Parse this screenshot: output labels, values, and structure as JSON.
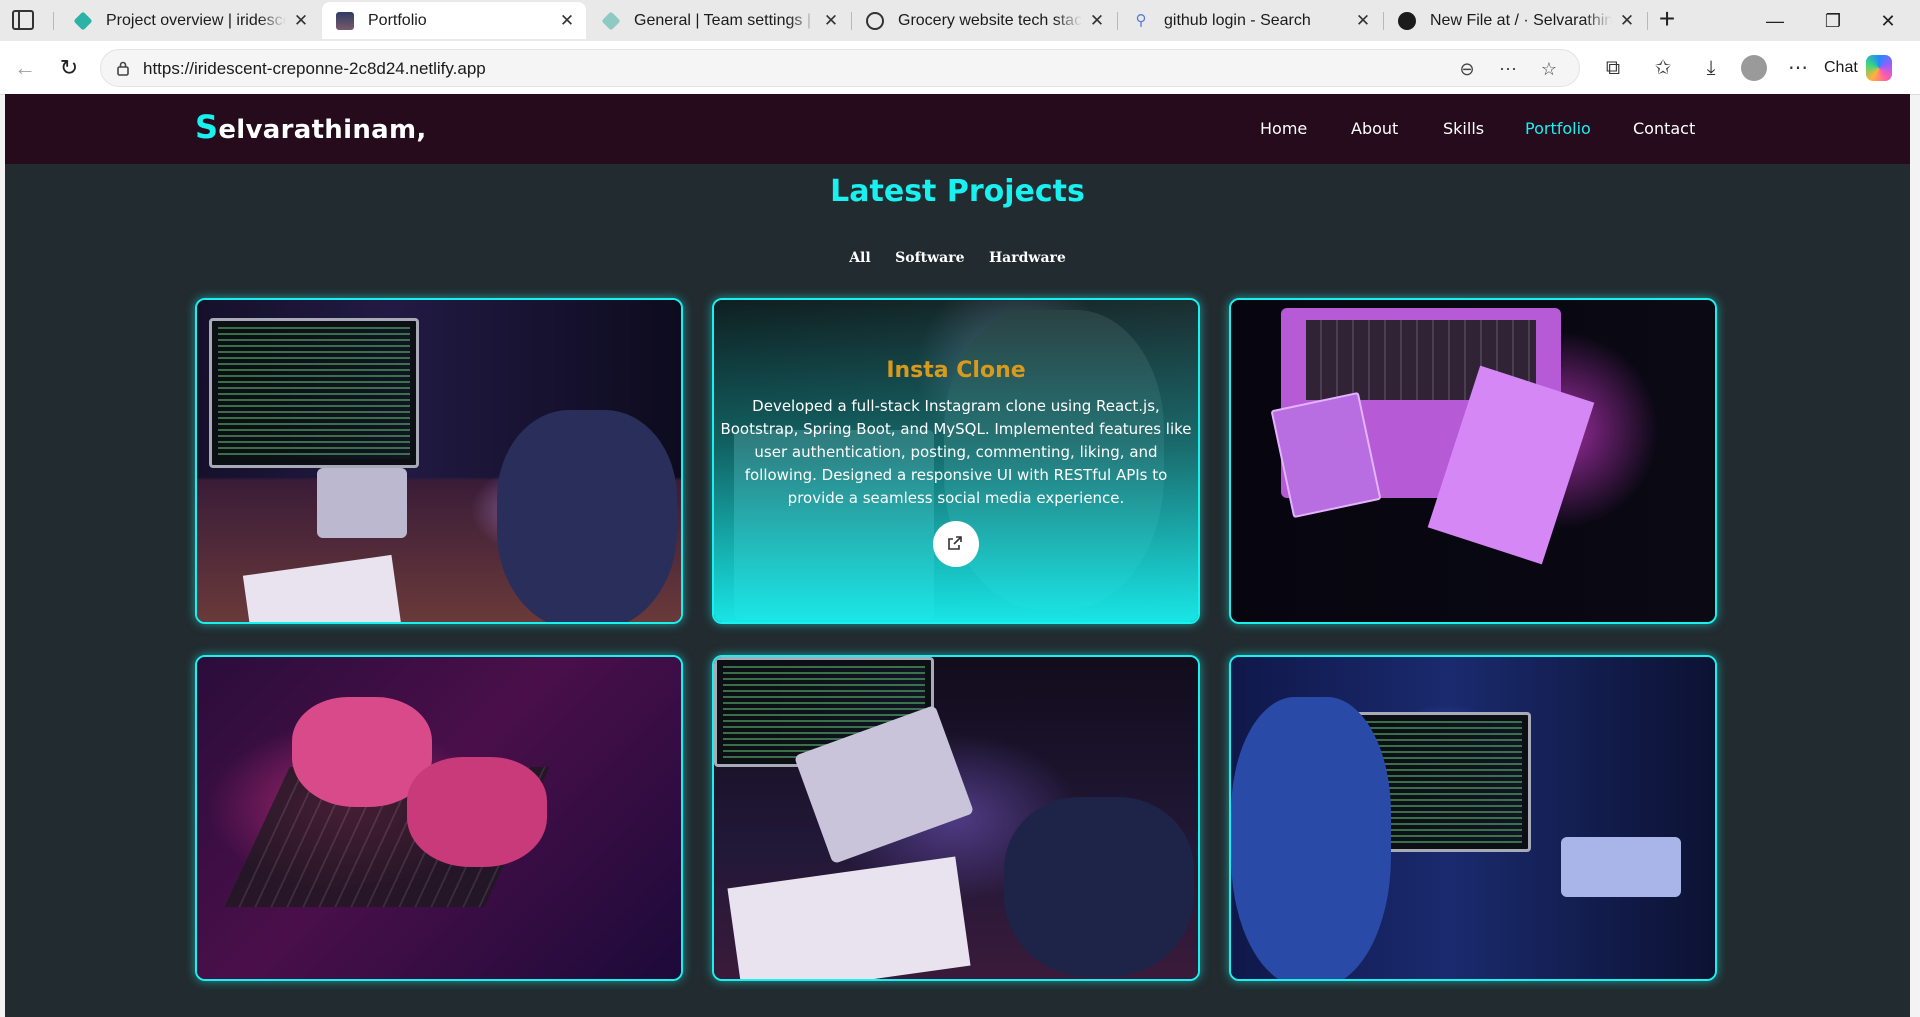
{
  "browser": {
    "tabs": [
      {
        "label": "Project overview | iridescent-creponne",
        "icon": "netlify-diamond-icon",
        "active": false
      },
      {
        "label": "Portfolio",
        "icon": "portfolio-favicon",
        "active": true
      },
      {
        "label": "General | Team settings | selvarathinam",
        "icon": "netlify-diamond-icon",
        "active": false
      },
      {
        "label": "Grocery website tech stack",
        "icon": "chatgpt-icon",
        "active": false
      },
      {
        "label": "github login - Search",
        "icon": "search-icon",
        "active": false
      },
      {
        "label": "New File at / · Selvarathinam",
        "icon": "github-icon",
        "active": false
      }
    ],
    "url": "https://iridescent-creponne-2c8d24.netlify.app",
    "chat_label": "Chat"
  },
  "site": {
    "brand_initial": "S",
    "brand_rest": "elvarathinam,",
    "nav": [
      {
        "label": "Home",
        "active": false
      },
      {
        "label": "About",
        "active": false
      },
      {
        "label": "Skills",
        "active": false
      },
      {
        "label": "Portfolio",
        "active": true
      },
      {
        "label": "Contact",
        "active": false
      }
    ],
    "accent_color": "#19f0f0",
    "nav_bg_color": "#250b1c",
    "section_title": "Latest Projects",
    "filters": [
      "All",
      "Software",
      "Hardware"
    ],
    "hovered_project": {
      "title": "Insta Clone",
      "description": "Developed a full-stack Instagram clone using React.js, Bootstrap, Spring Boot, and MySQL. Implemented features like user authentication, posting, commenting, liking, and following. Designed a responsive UI with RESTful APIs to provide a seamless social media experience.",
      "link_icon": "external-link-icon"
    }
  }
}
